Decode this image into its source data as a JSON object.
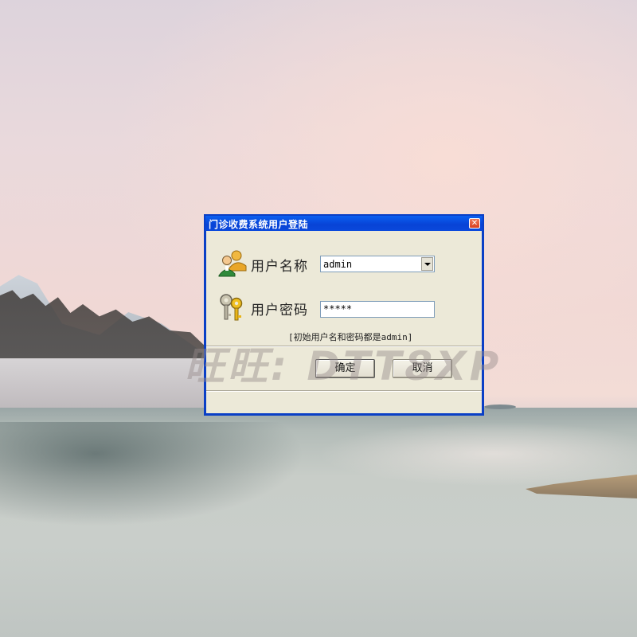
{
  "window": {
    "title": "门诊收费系统用户登陆",
    "close_glyph": "✕"
  },
  "form": {
    "username_label": "用户名称",
    "username_value": "admin",
    "password_label": "用户密码",
    "password_value": "*****",
    "hint": "[初始用户名和密码都是admin]"
  },
  "buttons": {
    "ok": "确定",
    "cancel": "取消"
  },
  "watermark": "旺旺: DTT8XP",
  "icons": {
    "users": "users-icon",
    "keys": "keys-icon"
  },
  "colors": {
    "titlebar": "#0a4fe0",
    "dialog_face": "#ece9d8",
    "close_button": "#e0522e"
  }
}
